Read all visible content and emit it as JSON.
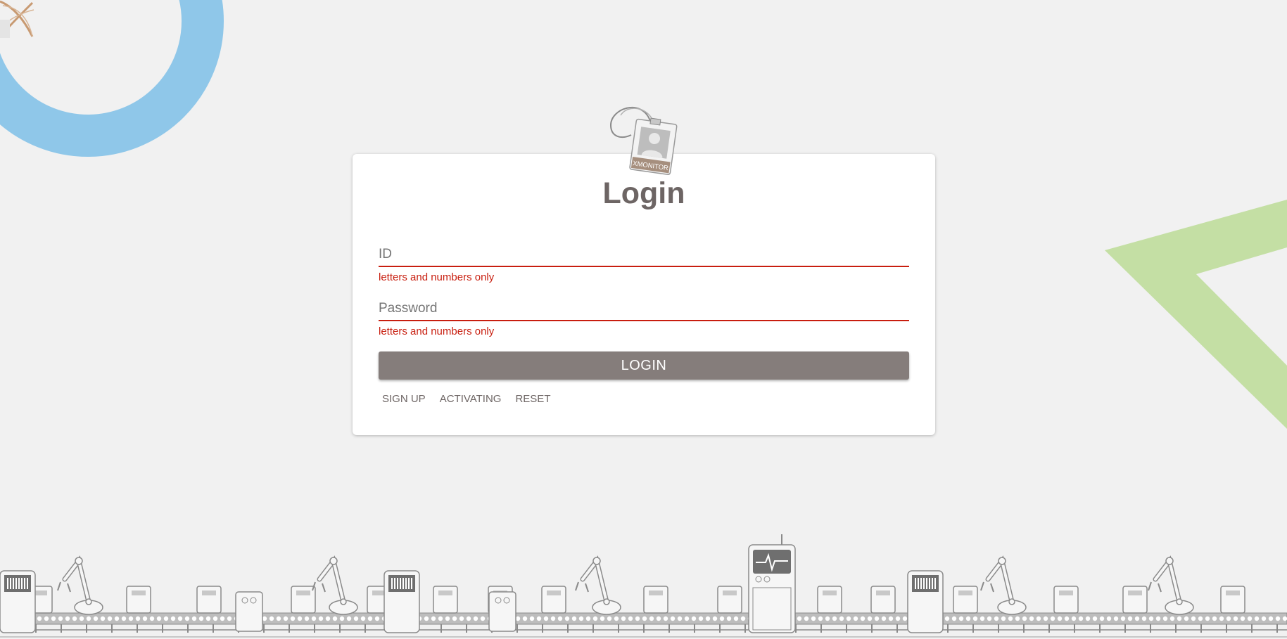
{
  "colors": {
    "background": "#f1f1f1",
    "error": "#c81e0f",
    "title": "#6d6564",
    "button": "#857d7b",
    "ring": "#8fc7e9",
    "triangle": "#c4dfa4"
  },
  "icons": {
    "logo": "xmonitor-logo-icon",
    "badge": "id-badge-icon"
  },
  "badge": {
    "text": "XMONITOR"
  },
  "login": {
    "title": "Login",
    "id_field": {
      "label": "ID",
      "hint": "letters and numbers only"
    },
    "password_field": {
      "label": "Password",
      "hint": "letters and numbers only"
    },
    "submit_label": "LOGIN",
    "links": {
      "signup": "SIGN UP",
      "activating": "ACTIVATING",
      "reset": "RESET"
    }
  }
}
